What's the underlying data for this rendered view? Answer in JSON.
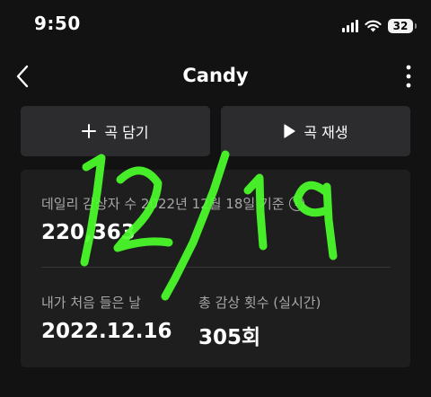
{
  "status_bar": {
    "time": "9:50",
    "battery": "32",
    "icons": [
      "signal-icon",
      "wifi-icon",
      "battery-icon"
    ]
  },
  "nav": {
    "title": "Candy",
    "back_icon": "chevron-left-icon",
    "more_icon": "more-vertical-icon"
  },
  "actions": {
    "add_label": "곡 담기",
    "add_icon": "plus-icon",
    "play_label": "곡 재생",
    "play_icon": "play-icon"
  },
  "stats": {
    "daily_label": "데일리 감상자 수 2022년 12월 18일 기준",
    "daily_value": "220,363",
    "first_listen_label": "내가 처음 들은 날",
    "first_listen_value": "2022.12.16",
    "total_plays_label": "총 감상 횟수 (실시간)",
    "total_plays_value": "305회"
  },
  "annotation": {
    "text": "12/19",
    "color": "#4cff2b"
  },
  "colors": {
    "background": "#121212",
    "card": "#1e1e1e",
    "button": "#2c2c2e",
    "muted_text": "#a7a7a7"
  }
}
